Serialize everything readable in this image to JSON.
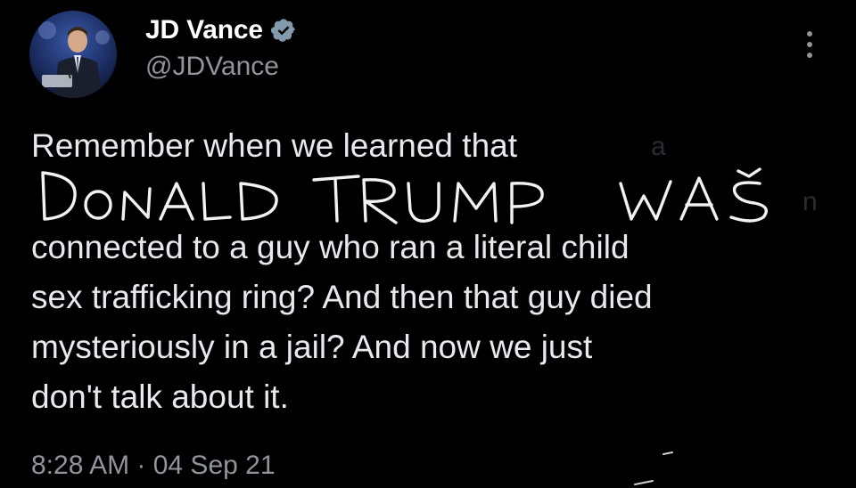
{
  "tweet": {
    "author": {
      "display_name": "JD Vance",
      "handle": "@JDVance",
      "verified_icon": "verified-badge-icon",
      "avatar_icon": "avatar"
    },
    "more_icon": "more-options-icon",
    "text_lines": [
      "Remember when we learned that",
      "connected to a guy who ran a literal child",
      "sex trafficking ring? And then that guy died",
      "mysteriously in a jail? And now we just",
      "don't talk about it."
    ],
    "handwritten_overlay": "DONALD TRUMP WAS",
    "timestamp": "8:28 AM · 04 Sep 21"
  },
  "colors": {
    "background": "#000000",
    "text": "#e7e9ea",
    "muted": "#8f959a",
    "verified": "#829aab",
    "handwriting": "#f2f2f2"
  }
}
